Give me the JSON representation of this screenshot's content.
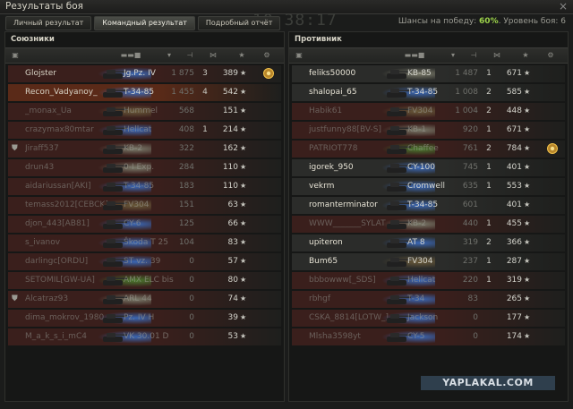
{
  "window": {
    "title": "Результаты боя",
    "close": "×",
    "clock": "10:38:17"
  },
  "tabs": [
    {
      "label": "Личный результат",
      "active": false
    },
    {
      "label": "Командный результат",
      "active": true
    },
    {
      "label": "Подробный отчёт",
      "active": false
    }
  ],
  "win_chance": {
    "label": "Шансы на победу: ",
    "value": "60%",
    "level_label": ". Уровень боя: 6"
  },
  "allies": {
    "title": "Союзники",
    "rows": [
      {
        "name": "Glojster",
        "vehicle": "Jg.Pz. IV",
        "dmg": "1 875",
        "kills": "3",
        "xp": "389",
        "medal": true,
        "cls": "td",
        "tint": "#3a1f1c",
        "dead": false
      },
      {
        "name": "Recon_Vadyanoy_",
        "vehicle": "T-34-85",
        "dmg": "1 455",
        "kills": "4",
        "xp": "542",
        "medal": false,
        "cls": "mt",
        "tint": "#5a2a18",
        "dead": false
      },
      {
        "name": "_monax_Ua",
        "vehicle": "Hummel",
        "dmg": "568",
        "kills": "",
        "xp": "151",
        "medal": false,
        "cls": "spg",
        "tint": "#3a1f1c",
        "dead": true
      },
      {
        "name": "crazymax80mtar",
        "vehicle": "Hellcat",
        "dmg": "408",
        "kills": "1",
        "xp": "214",
        "medal": false,
        "cls": "td",
        "tint": "#3a1f1c",
        "dead": true
      },
      {
        "name": "Jiraff537",
        "vehicle": "KB-2",
        "dmg": "322",
        "kills": "",
        "xp": "162",
        "medal": false,
        "cls": "ht",
        "tint": "#3a1f1c",
        "dead": true,
        "icon": "platoon"
      },
      {
        "name": "drun43",
        "vehicle": "0-I Exp.",
        "dmg": "284",
        "kills": "",
        "xp": "110",
        "medal": false,
        "cls": "ht",
        "tint": "#3a1f1c",
        "dead": true
      },
      {
        "name": "aidariussan[AKI]",
        "vehicle": "T-34-85",
        "dmg": "183",
        "kills": "",
        "xp": "110",
        "medal": false,
        "cls": "mt",
        "tint": "#3a1f1c",
        "dead": true
      },
      {
        "name": "temass2012[CEBCK]",
        "vehicle": "FV304",
        "dmg": "151",
        "kills": "",
        "xp": "63",
        "medal": false,
        "cls": "spg",
        "tint": "#3a1f1c",
        "dead": true
      },
      {
        "name": "djon_443[AB81]",
        "vehicle": "CY-6",
        "dmg": "125",
        "kills": "",
        "xp": "66",
        "medal": false,
        "cls": "td",
        "tint": "#3a1f1c",
        "dead": true
      },
      {
        "name": "s_ivanov",
        "vehicle": "Škoda T 25",
        "dmg": "104",
        "kills": "",
        "xp": "83",
        "medal": false,
        "cls": "mt",
        "tint": "#3a1f1c",
        "dead": true
      },
      {
        "name": "darlingc[ORDU]",
        "vehicle": "ST vz. 39",
        "dmg": "0",
        "kills": "",
        "xp": "57",
        "medal": false,
        "cls": "mt",
        "tint": "#3a1f1c",
        "dead": true
      },
      {
        "name": "SETOMIL[GW-UA]",
        "vehicle": "AMX ELC bis",
        "dmg": "0",
        "kills": "",
        "xp": "80",
        "medal": false,
        "cls": "lt",
        "tint": "#3a1f1c",
        "dead": true
      },
      {
        "name": "Alcatraz93",
        "vehicle": "ARL 44",
        "dmg": "0",
        "kills": "",
        "xp": "74",
        "medal": false,
        "cls": "ht",
        "tint": "#3a1f1c",
        "dead": true,
        "icon": "platoon"
      },
      {
        "name": "dima_mokrov_1980",
        "vehicle": "Pz. IV H",
        "dmg": "0",
        "kills": "",
        "xp": "39",
        "medal": false,
        "cls": "mt",
        "tint": "#3a1f1c",
        "dead": true
      },
      {
        "name": "M_a_k_s_i_mC4",
        "vehicle": "VK 30.01 D",
        "dmg": "0",
        "kills": "",
        "xp": "53",
        "medal": false,
        "cls": "mt",
        "tint": "#3a1f1c",
        "dead": true
      }
    ]
  },
  "enemies": {
    "title": "Противник",
    "rows": [
      {
        "name": "feliks50000",
        "vehicle": "KB-85",
        "dmg": "1 487",
        "kills": "1",
        "xp": "671",
        "medal": false,
        "cls": "ht",
        "tint": "#2b2c2a",
        "dead": false
      },
      {
        "name": "shalopai_65",
        "vehicle": "T-34-85",
        "dmg": "1 008",
        "kills": "2",
        "xp": "585",
        "medal": false,
        "cls": "mt",
        "tint": "#2b2c2a",
        "dead": false
      },
      {
        "name": "Habik61",
        "vehicle": "FV304",
        "dmg": "1 004",
        "kills": "2",
        "xp": "448",
        "medal": false,
        "cls": "spg",
        "tint": "#3a1f1c",
        "dead": true
      },
      {
        "name": "justfunny88[BV-S]",
        "vehicle": "KB-1",
        "dmg": "920",
        "kills": "1",
        "xp": "671",
        "medal": false,
        "cls": "ht",
        "tint": "#3a1f1c",
        "dead": true
      },
      {
        "name": "PATRIOT778",
        "vehicle": "Chaffee",
        "dmg": "761",
        "kills": "2",
        "xp": "784",
        "medal": true,
        "cls": "lt",
        "tint": "#3a1f1c",
        "dead": true
      },
      {
        "name": "igorek_950",
        "vehicle": "CY-100",
        "dmg": "745",
        "kills": "1",
        "xp": "401",
        "medal": false,
        "cls": "td",
        "tint": "#2b2c2a",
        "dead": false
      },
      {
        "name": "vekrm",
        "vehicle": "Cromwell",
        "dmg": "635",
        "kills": "1",
        "xp": "553",
        "medal": false,
        "cls": "mt",
        "tint": "#2b2c2a",
        "dead": false
      },
      {
        "name": "romanterminator",
        "vehicle": "T-34-85",
        "dmg": "601",
        "kills": "",
        "xp": "401",
        "medal": false,
        "cls": "mt",
        "tint": "#2b2c2a",
        "dead": false
      },
      {
        "name": "WWW_______SYLAT",
        "vehicle": "KB-2",
        "dmg": "440",
        "kills": "1",
        "xp": "455",
        "medal": false,
        "cls": "ht",
        "tint": "#3a1f1c",
        "dead": true
      },
      {
        "name": "upiteron",
        "vehicle": "AT 8",
        "dmg": "319",
        "kills": "2",
        "xp": "366",
        "medal": false,
        "cls": "td",
        "tint": "#2b2c2a",
        "dead": false
      },
      {
        "name": "Bum65",
        "vehicle": "FV304",
        "dmg": "237",
        "kills": "1",
        "xp": "287",
        "medal": false,
        "cls": "spg",
        "tint": "#2b2c2a",
        "dead": false
      },
      {
        "name": "bbbowww[_SDS]",
        "vehicle": "Hellcat",
        "dmg": "220",
        "kills": "1",
        "xp": "319",
        "medal": false,
        "cls": "td",
        "tint": "#3a1f1c",
        "dead": true
      },
      {
        "name": "rbhgf",
        "vehicle": "T-34",
        "dmg": "83",
        "kills": "",
        "xp": "265",
        "medal": false,
        "cls": "mt",
        "tint": "#3a1f1c",
        "dead": true
      },
      {
        "name": "CSKA_8814[LOTW_]",
        "vehicle": "Jackson",
        "dmg": "0",
        "kills": "",
        "xp": "177",
        "medal": false,
        "cls": "td",
        "tint": "#3a1f1c",
        "dead": true
      },
      {
        "name": "Mlsha3598yt",
        "vehicle": "CY-5",
        "dmg": "0",
        "kills": "",
        "xp": "174",
        "medal": false,
        "cls": "td",
        "tint": "#3a1f1c",
        "dead": true
      }
    ]
  },
  "star_glyph": "★",
  "watermark": "YAPLAKAL.COM"
}
